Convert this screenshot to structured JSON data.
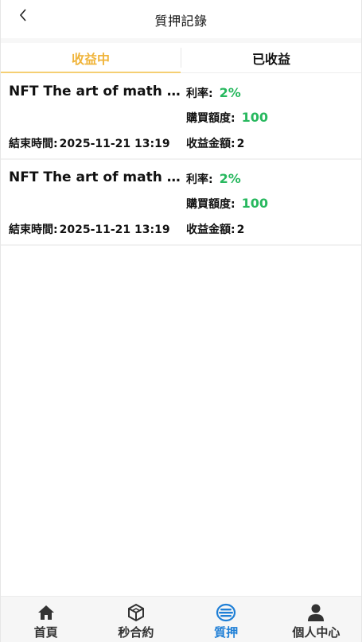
{
  "header": {
    "title": "質押記錄"
  },
  "tabs": [
    {
      "label": "收益中",
      "active": true
    },
    {
      "label": "已收益",
      "active": false
    }
  ],
  "records": [
    {
      "title": "NFT The art of math rabbit",
      "rate_label": "利率:",
      "rate_value": "2%",
      "amount_label": "購買額度:",
      "amount_value": "100",
      "end_label": "結束時間:",
      "end_value": "2025-11-21 13:19",
      "income_label": "收益金額:",
      "income_value": "2"
    },
    {
      "title": "NFT The art of math rabbit",
      "rate_label": "利率:",
      "rate_value": "2%",
      "amount_label": "購買額度:",
      "amount_value": "100",
      "end_label": "結束時間:",
      "end_value": "2025-11-21 13:19",
      "income_label": "收益金額:",
      "income_value": "2"
    }
  ],
  "bottom_nav": [
    {
      "label": "首頁",
      "icon": "home-icon"
    },
    {
      "label": "秒合約",
      "icon": "cube-icon"
    },
    {
      "label": "質押",
      "icon": "stake-icon",
      "active": true
    },
    {
      "label": "個人中心",
      "icon": "user-icon"
    }
  ],
  "colors": {
    "accent": "#f0b43a",
    "positive": "#27b85e",
    "nav_active": "#1f7fd6"
  }
}
